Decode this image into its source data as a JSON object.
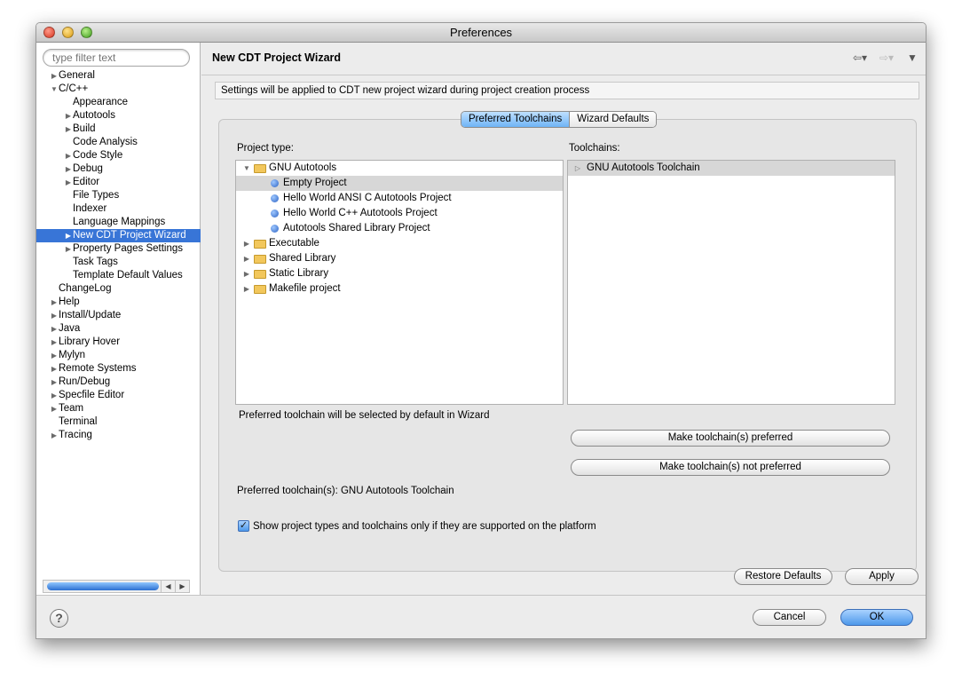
{
  "window": {
    "title": "Preferences"
  },
  "sidebar": {
    "filter_placeholder": "type filter text",
    "items": [
      {
        "label": "General",
        "level": 0,
        "expander": "collapsed"
      },
      {
        "label": "C/C++",
        "level": 0,
        "expander": "expanded"
      },
      {
        "label": "Appearance",
        "level": 1,
        "expander": "none"
      },
      {
        "label": "Autotools",
        "level": 1,
        "expander": "collapsed"
      },
      {
        "label": "Build",
        "level": 1,
        "expander": "collapsed"
      },
      {
        "label": "Code Analysis",
        "level": 1,
        "expander": "none"
      },
      {
        "label": "Code Style",
        "level": 1,
        "expander": "collapsed"
      },
      {
        "label": "Debug",
        "level": 1,
        "expander": "collapsed"
      },
      {
        "label": "Editor",
        "level": 1,
        "expander": "collapsed"
      },
      {
        "label": "File Types",
        "level": 1,
        "expander": "none"
      },
      {
        "label": "Indexer",
        "level": 1,
        "expander": "none"
      },
      {
        "label": "Language Mappings",
        "level": 1,
        "expander": "none"
      },
      {
        "label": "New CDT Project Wizard",
        "level": 1,
        "expander": "collapsed",
        "selected": true
      },
      {
        "label": "Property Pages Settings",
        "level": 1,
        "expander": "collapsed"
      },
      {
        "label": "Task Tags",
        "level": 1,
        "expander": "none"
      },
      {
        "label": "Template Default Values",
        "level": 1,
        "expander": "none"
      },
      {
        "label": "ChangeLog",
        "level": 0,
        "expander": "none"
      },
      {
        "label": "Help",
        "level": 0,
        "expander": "collapsed"
      },
      {
        "label": "Install/Update",
        "level": 0,
        "expander": "collapsed"
      },
      {
        "label": "Java",
        "level": 0,
        "expander": "collapsed"
      },
      {
        "label": "Library Hover",
        "level": 0,
        "expander": "collapsed"
      },
      {
        "label": "Mylyn",
        "level": 0,
        "expander": "collapsed"
      },
      {
        "label": "Remote Systems",
        "level": 0,
        "expander": "collapsed"
      },
      {
        "label": "Run/Debug",
        "level": 0,
        "expander": "collapsed"
      },
      {
        "label": "Specfile Editor",
        "level": 0,
        "expander": "collapsed"
      },
      {
        "label": "Team",
        "level": 0,
        "expander": "collapsed"
      },
      {
        "label": "Terminal",
        "level": 0,
        "expander": "none"
      },
      {
        "label": "Tracing",
        "level": 0,
        "expander": "collapsed"
      }
    ]
  },
  "page": {
    "title": "New CDT Project Wizard",
    "info": "Settings will be applied to CDT new project wizard during project creation process",
    "tabs": [
      {
        "label": "Preferred Toolchains",
        "active": true
      },
      {
        "label": "Wizard Defaults",
        "active": false
      }
    ],
    "project_type_label": "Project type:",
    "toolchains_label": "Toolchains:",
    "project_types": [
      {
        "label": "GNU Autotools",
        "kind": "folder",
        "expander": "expanded",
        "level": 0
      },
      {
        "label": "Empty Project",
        "kind": "item",
        "level": 1,
        "selected": true
      },
      {
        "label": "Hello World ANSI C Autotools Project",
        "kind": "item",
        "level": 1
      },
      {
        "label": "Hello World C++ Autotools Project",
        "kind": "item",
        "level": 1
      },
      {
        "label": "Autotools Shared Library Project",
        "kind": "item",
        "level": 1
      },
      {
        "label": "Executable",
        "kind": "folder",
        "expander": "collapsed",
        "level": 0
      },
      {
        "label": "Shared Library",
        "kind": "folder",
        "expander": "collapsed",
        "level": 0
      },
      {
        "label": "Static Library",
        "kind": "folder",
        "expander": "collapsed",
        "level": 0
      },
      {
        "label": "Makefile project",
        "kind": "folder",
        "expander": "collapsed",
        "level": 0
      }
    ],
    "toolchains": [
      {
        "label": "GNU Autotools Toolchain",
        "preferred": true
      }
    ],
    "preferred_note": "Preferred toolchain will be selected by default in Wizard",
    "make_preferred": "Make toolchain(s) preferred",
    "make_not_preferred": "Make toolchain(s) not preferred",
    "preferred_status": "Preferred toolchain(s): GNU Autotools Toolchain",
    "show_supported_label": "Show project types and toolchains only if they are supported on the platform",
    "show_supported_checked": true,
    "restore_defaults": "Restore Defaults",
    "apply": "Apply"
  },
  "footer": {
    "cancel": "Cancel",
    "ok": "OK"
  }
}
